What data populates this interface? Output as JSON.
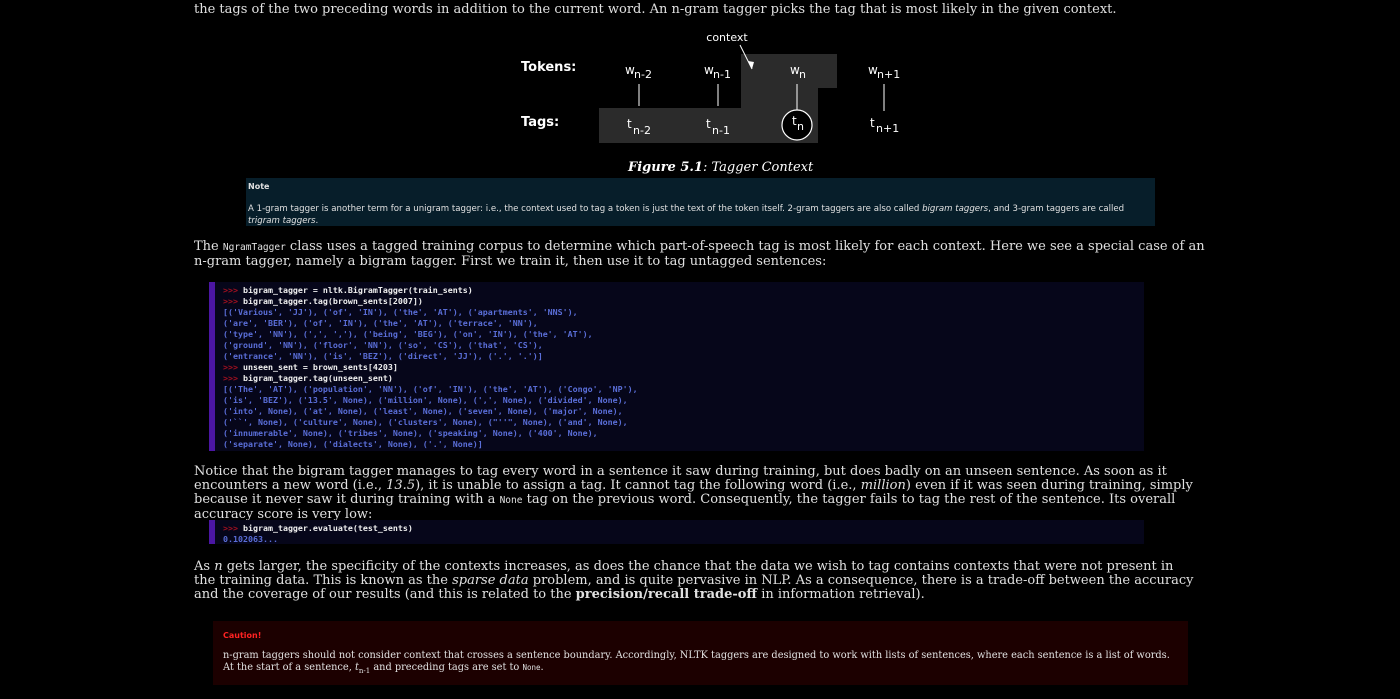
{
  "intro_line": "the tags of the two preceding words in addition to the current word. An n-gram tagger picks the tag that is most likely in the given context.",
  "figure": {
    "context_label": "context",
    "tokens_label": "Tokens:",
    "tags_label": "Tags:",
    "words": [
      "w",
      "w",
      "w",
      "w"
    ],
    "word_subs": [
      "n-2",
      "n-1",
      "n",
      "n+1"
    ],
    "tags": [
      "t",
      "t",
      "t",
      "t"
    ],
    "tag_subs": [
      "n-2",
      "n-1",
      "n",
      "n+1"
    ],
    "caption_bold": "Figure 5.1",
    "caption_rest": ": Tagger Context"
  },
  "note": {
    "title": "Note",
    "text_1": "A 1-gram tagger is another term for a unigram tagger: i.e., the context used to tag a token is just the text of the token itself. 2-gram taggers are also called ",
    "em_1": "bigram taggers",
    "text_2": ", and 3-gram taggers are called ",
    "em_2": "trigram taggers",
    "text_3": "."
  },
  "para1": {
    "t1": "The ",
    "code": "NgramTagger",
    "t2": " class uses a tagged training corpus to determine which part-of-speech tag is most likely for each context. Here we see a special case of an n-gram tagger, namely a bigram tagger. First we train it, then use it to tag untagged sentences:"
  },
  "code1": [
    {
      "type": "cmd",
      "prompt": ">>> ",
      "text": "bigram_tagger = nltk.BigramTagger(train_sents)"
    },
    {
      "type": "cmd",
      "prompt": ">>> ",
      "text": "bigram_tagger.tag(brown_sents[2007])"
    },
    {
      "type": "out",
      "text": "[('Various', 'JJ'), ('of', 'IN'), ('the', 'AT'), ('apartments', 'NNS'),"
    },
    {
      "type": "out",
      "text": "('are', 'BER'), ('of', 'IN'), ('the', 'AT'), ('terrace', 'NN'),"
    },
    {
      "type": "out",
      "text": "('type', 'NN'), (',', ','), ('being', 'BEG'), ('on', 'IN'), ('the', 'AT'),"
    },
    {
      "type": "out",
      "text": "('ground', 'NN'), ('floor', 'NN'), ('so', 'CS'), ('that', 'CS'),"
    },
    {
      "type": "out",
      "text": "('entrance', 'NN'), ('is', 'BEZ'), ('direct', 'JJ'), ('.', '.')]"
    },
    {
      "type": "cmd",
      "prompt": ">>> ",
      "text": "unseen_sent = brown_sents[4203]"
    },
    {
      "type": "cmd",
      "prompt": ">>> ",
      "text": "bigram_tagger.tag(unseen_sent)"
    },
    {
      "type": "out",
      "text": "[('The', 'AT'), ('population', 'NN'), ('of', 'IN'), ('the', 'AT'), ('Congo', 'NP'),"
    },
    {
      "type": "out",
      "text": "('is', 'BEZ'), ('13.5', None), ('million', None), (',', None), ('divided', None),"
    },
    {
      "type": "out",
      "text": "('into', None), ('at', None), ('least', None), ('seven', None), ('major', None),"
    },
    {
      "type": "out",
      "text": "('``', None), ('culture', None), ('clusters', None), (\"''\", None), ('and', None),"
    },
    {
      "type": "out",
      "text": "('innumerable', None), ('tribes', None), ('speaking', None), ('400', None),"
    },
    {
      "type": "out",
      "text": "('separate', None), ('dialects', None), ('.', None)]"
    }
  ],
  "para2": {
    "t1": "Notice that the bigram tagger manages to tag every word in a sentence it saw during training, but does badly on an unseen sentence. As soon as it encounters a new word (i.e., ",
    "em1": "13.5",
    "t2": "), it is unable to assign a tag. It cannot tag the following word (i.e., ",
    "em2": "million",
    "t3": ") even if it was seen during training, simply because it never saw it during training with a ",
    "code": "None",
    "t4": " tag on the previous word. Consequently, the tagger fails to tag the rest of the sentence. Its overall accuracy score is very low:"
  },
  "code2": [
    {
      "type": "cmd",
      "prompt": ">>> ",
      "text": "bigram_tagger.evaluate(test_sents)"
    },
    {
      "type": "out",
      "text": "0.102063..."
    }
  ],
  "para3": {
    "t1": "As ",
    "em1": "n",
    "t2": " gets larger, the specificity of the contexts increases, as does the chance that the data we wish to tag contains contexts that were not present in the training data. This is known as the ",
    "em2": "sparse data",
    "t3": " problem, and is quite pervasive in NLP. As a consequence, there is a trade-off between the accuracy and the coverage of our results (and this is related to the ",
    "strong": "precision/recall trade-off",
    "t4": " in information retrieval)."
  },
  "caution": {
    "title": "Caution!",
    "t1": "n-gram taggers should not consider context that crosses a sentence boundary. Accordingly, NLTK taggers are designed to work with lists of sentences, where each sentence is a list of words. At the start of a sentence, ",
    "tvar": "t",
    "tsub": "n-1",
    "t2": " and preceding tags are set to ",
    "code": "None",
    "t3": "."
  },
  "colors": {
    "background": "#000000",
    "code_bg": "#06061a",
    "code_bar": "#4b16a3",
    "prompt": "#a01020",
    "output": "#5a6ed8",
    "note_bg": "#071e2a",
    "caution_bg": "#1c0000",
    "caution_title": "#ff2222"
  }
}
